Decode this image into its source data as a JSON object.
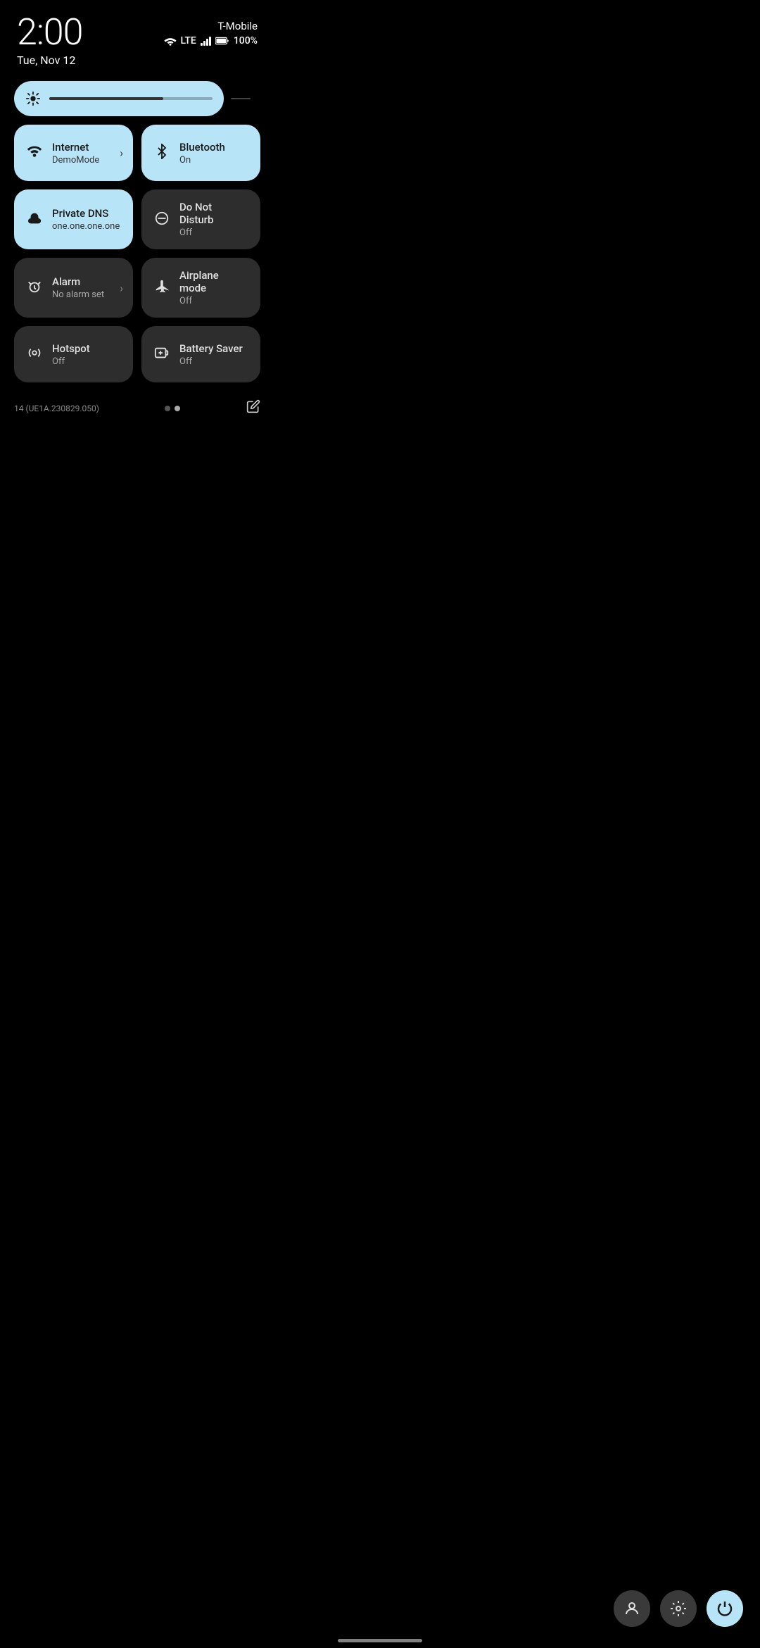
{
  "statusBar": {
    "time": "2:00",
    "date": "Tue, Nov 12",
    "carrier": "T-Mobile",
    "battery": "100%",
    "lte": "LTE"
  },
  "brightness": {
    "ariaLabel": "Brightness slider"
  },
  "tiles": [
    {
      "id": "internet",
      "title": "Internet",
      "subtitle": "DemoMode",
      "active": true,
      "hasChevron": true,
      "icon": "wifi"
    },
    {
      "id": "bluetooth",
      "title": "Bluetooth",
      "subtitle": "On",
      "active": true,
      "hasChevron": false,
      "icon": "bluetooth"
    },
    {
      "id": "private-dns",
      "title": "Private DNS",
      "subtitle": "one.one.one.one",
      "active": true,
      "hasChevron": false,
      "icon": "cloud"
    },
    {
      "id": "do-not-disturb",
      "title": "Do Not Disturb",
      "subtitle": "Off",
      "active": false,
      "hasChevron": false,
      "icon": "dnd"
    },
    {
      "id": "alarm",
      "title": "Alarm",
      "subtitle": "No alarm set",
      "active": false,
      "hasChevron": true,
      "icon": "alarm"
    },
    {
      "id": "airplane-mode",
      "title": "Airplane mode",
      "subtitle": "Off",
      "active": false,
      "hasChevron": false,
      "icon": "airplane"
    },
    {
      "id": "hotspot",
      "title": "Hotspot",
      "subtitle": "Off",
      "active": false,
      "hasChevron": false,
      "icon": "hotspot"
    },
    {
      "id": "battery-saver",
      "title": "Battery Saver",
      "subtitle": "Off",
      "active": false,
      "hasChevron": false,
      "icon": "battery-saver"
    }
  ],
  "footer": {
    "buildVersion": "14 (UE1A.230829.050)",
    "editLabel": "Edit"
  },
  "bottomNav": {
    "userLabel": "User",
    "settingsLabel": "Settings",
    "powerLabel": "Power"
  }
}
